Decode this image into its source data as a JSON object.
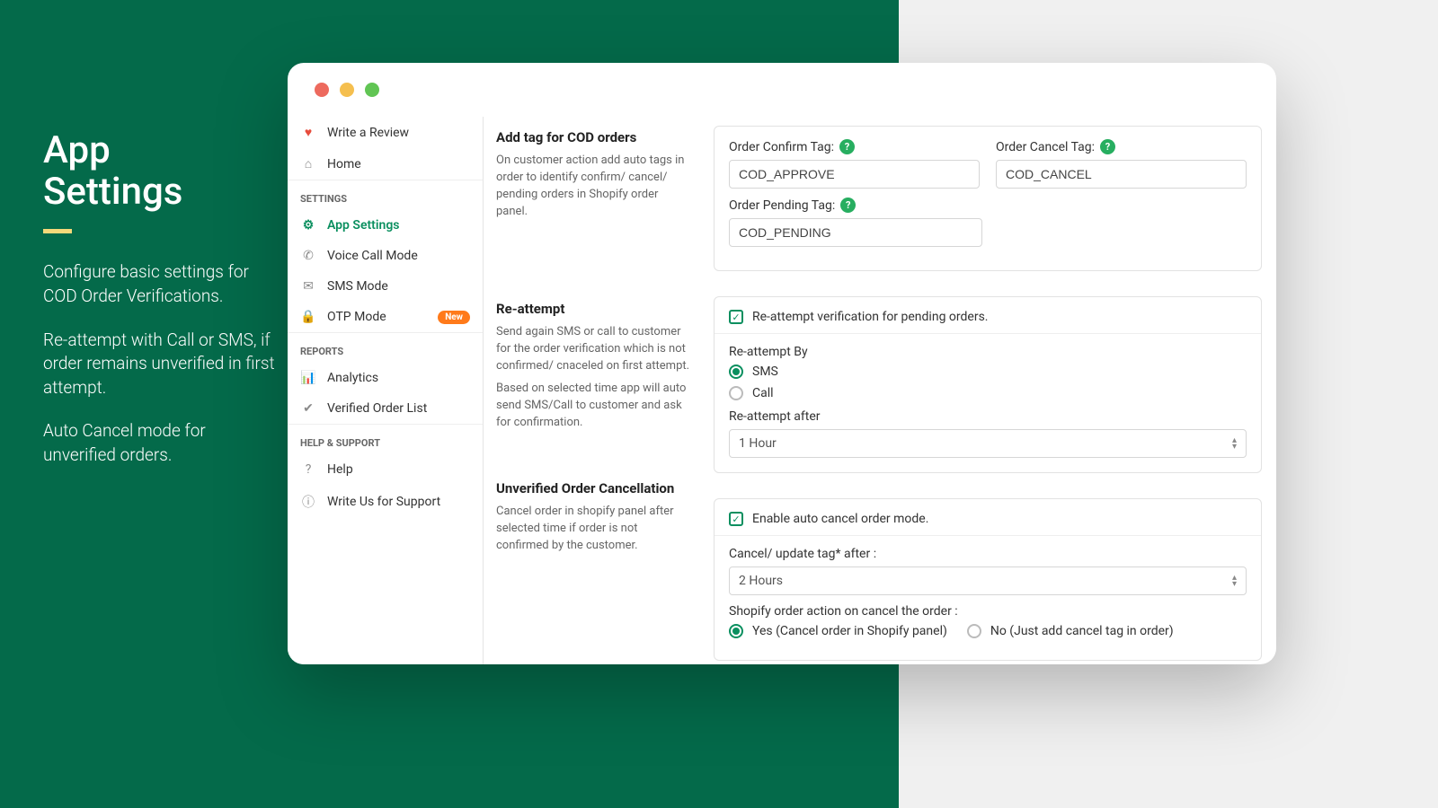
{
  "leftPanel": {
    "title1": "App",
    "title2": "Settings",
    "p1": "Configure basic settings for COD Order Verifications.",
    "p2": "Re-attempt with Call or SMS, if order remains unverified in first attempt.",
    "p3": "Auto Cancel mode for unverified orders."
  },
  "sidebar": {
    "writeReview": "Write a Review",
    "home": "Home",
    "settingsHeading": "SETTINGS",
    "appSettings": "App Settings",
    "voiceCallMode": "Voice Call Mode",
    "smsMode": "SMS Mode",
    "otpMode": "OTP Mode",
    "newBadge": "New",
    "reportsHeading": "REPORTS",
    "analytics": "Analytics",
    "verifiedOrderList": "Verified Order List",
    "helpSupportHeading": "HELP & SUPPORT",
    "help": "Help",
    "writeUs": "Write Us for Support"
  },
  "sections": {
    "tags": {
      "title": "Add tag for COD orders",
      "desc": "On customer action add auto tags in order to identify confirm/ cancel/ pending orders in Shopify order panel.",
      "confirmLabel": "Order Confirm Tag:",
      "cancelLabel": "Order Cancel Tag:",
      "pendingLabel": "Order Pending Tag:",
      "confirmVal": "COD_APPROVE",
      "cancelVal": "COD_CANCEL",
      "pendingVal": "COD_PENDING"
    },
    "reattempt": {
      "title": "Re-attempt",
      "desc1": "Send again SMS or call to customer for the order verification which is not confirmed/ cnaceled on first attempt.",
      "desc2": "Based on selected time app will auto send SMS/Call to customer and ask for confirmation.",
      "chk": "Re-attempt verification for pending orders.",
      "byLabel": "Re-attempt By",
      "optSms": "SMS",
      "optCall": "Call",
      "afterLabel": "Re-attempt after",
      "afterVal": "1 Hour"
    },
    "cancel": {
      "title": "Unverified Order Cancellation",
      "desc": "Cancel order in shopify panel after selected time if order is not confirmed by the customer.",
      "chk": "Enable auto cancel order mode.",
      "afterLabel": "Cancel/ update tag* after :",
      "afterVal": "2 Hours",
      "actionLabel": "Shopify order action on cancel the order :",
      "optYes": "Yes (Cancel order in Shopify panel)",
      "optNo": "No (Just add cancel tag in order)"
    }
  }
}
